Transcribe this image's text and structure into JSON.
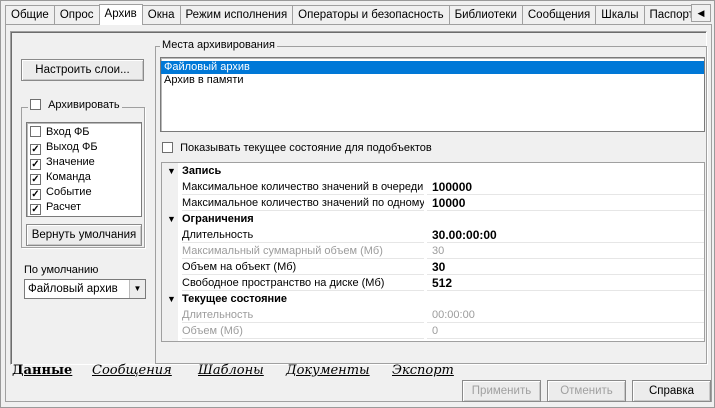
{
  "top_tabs": [
    "Общие",
    "Опрос",
    "Архив",
    "Окна",
    "Режим исполнения",
    "Операторы и безопасность",
    "Библиотеки",
    "Сообщения",
    "Шкалы",
    "Паспорта"
  ],
  "active_top_tab": "Архив",
  "tab_scroll_glyph": "◀",
  "left": {
    "configure_layers_button": "Настроить слои...",
    "archive_checkbox_label": "Архивировать",
    "options": [
      {
        "label": "Вход ФБ",
        "checked": false
      },
      {
        "label": "Выход ФБ",
        "checked": true
      },
      {
        "label": "Значение",
        "checked": true
      },
      {
        "label": "Команда",
        "checked": true
      },
      {
        "label": "Событие",
        "checked": true
      },
      {
        "label": "Расчет",
        "checked": true
      }
    ],
    "reset_defaults_button": "Вернуть умолчания",
    "default_label": "По умолчанию",
    "default_value": "Файловый архив"
  },
  "archive_places": {
    "title": "Места архивирования",
    "items": [
      {
        "label": "Файловый архив",
        "selected": true
      },
      {
        "label": "Архив в памяти",
        "selected": false
      }
    ],
    "show_state_checkbox_label": "Показывать текущее состояние для подобъектов"
  },
  "property_grid": {
    "categories": [
      {
        "name": "Запись",
        "rows": [
          {
            "name": "Максимальное количество значений в очереди",
            "value": "100000",
            "disabled": false
          },
          {
            "name": "Максимальное количество значений по одному",
            "value": "10000",
            "disabled": false
          }
        ]
      },
      {
        "name": "Ограничения",
        "rows": [
          {
            "name": "Длительность",
            "value": "30.00:00:00",
            "disabled": false
          },
          {
            "name": "Максимальный суммарный объем (Мб)",
            "value": "30",
            "disabled": true
          },
          {
            "name": "Объем на объект (Мб)",
            "value": "30",
            "disabled": false
          },
          {
            "name": "Свободное пространство на диске (Мб)",
            "value": "512",
            "disabled": false
          }
        ]
      },
      {
        "name": "Текущее состояние",
        "rows": [
          {
            "name": "Длительность",
            "value": "00:00:00",
            "disabled": true
          },
          {
            "name": "Объем (Мб)",
            "value": "0",
            "disabled": true
          }
        ]
      }
    ]
  },
  "bottom_tabs": [
    "Данные",
    "Сообщения",
    "Шаблоны",
    "Документы",
    "Экспорт"
  ],
  "active_bottom_tab": "Данные",
  "footer": {
    "apply": "Применить",
    "cancel": "Отменить",
    "help": "Справка"
  }
}
